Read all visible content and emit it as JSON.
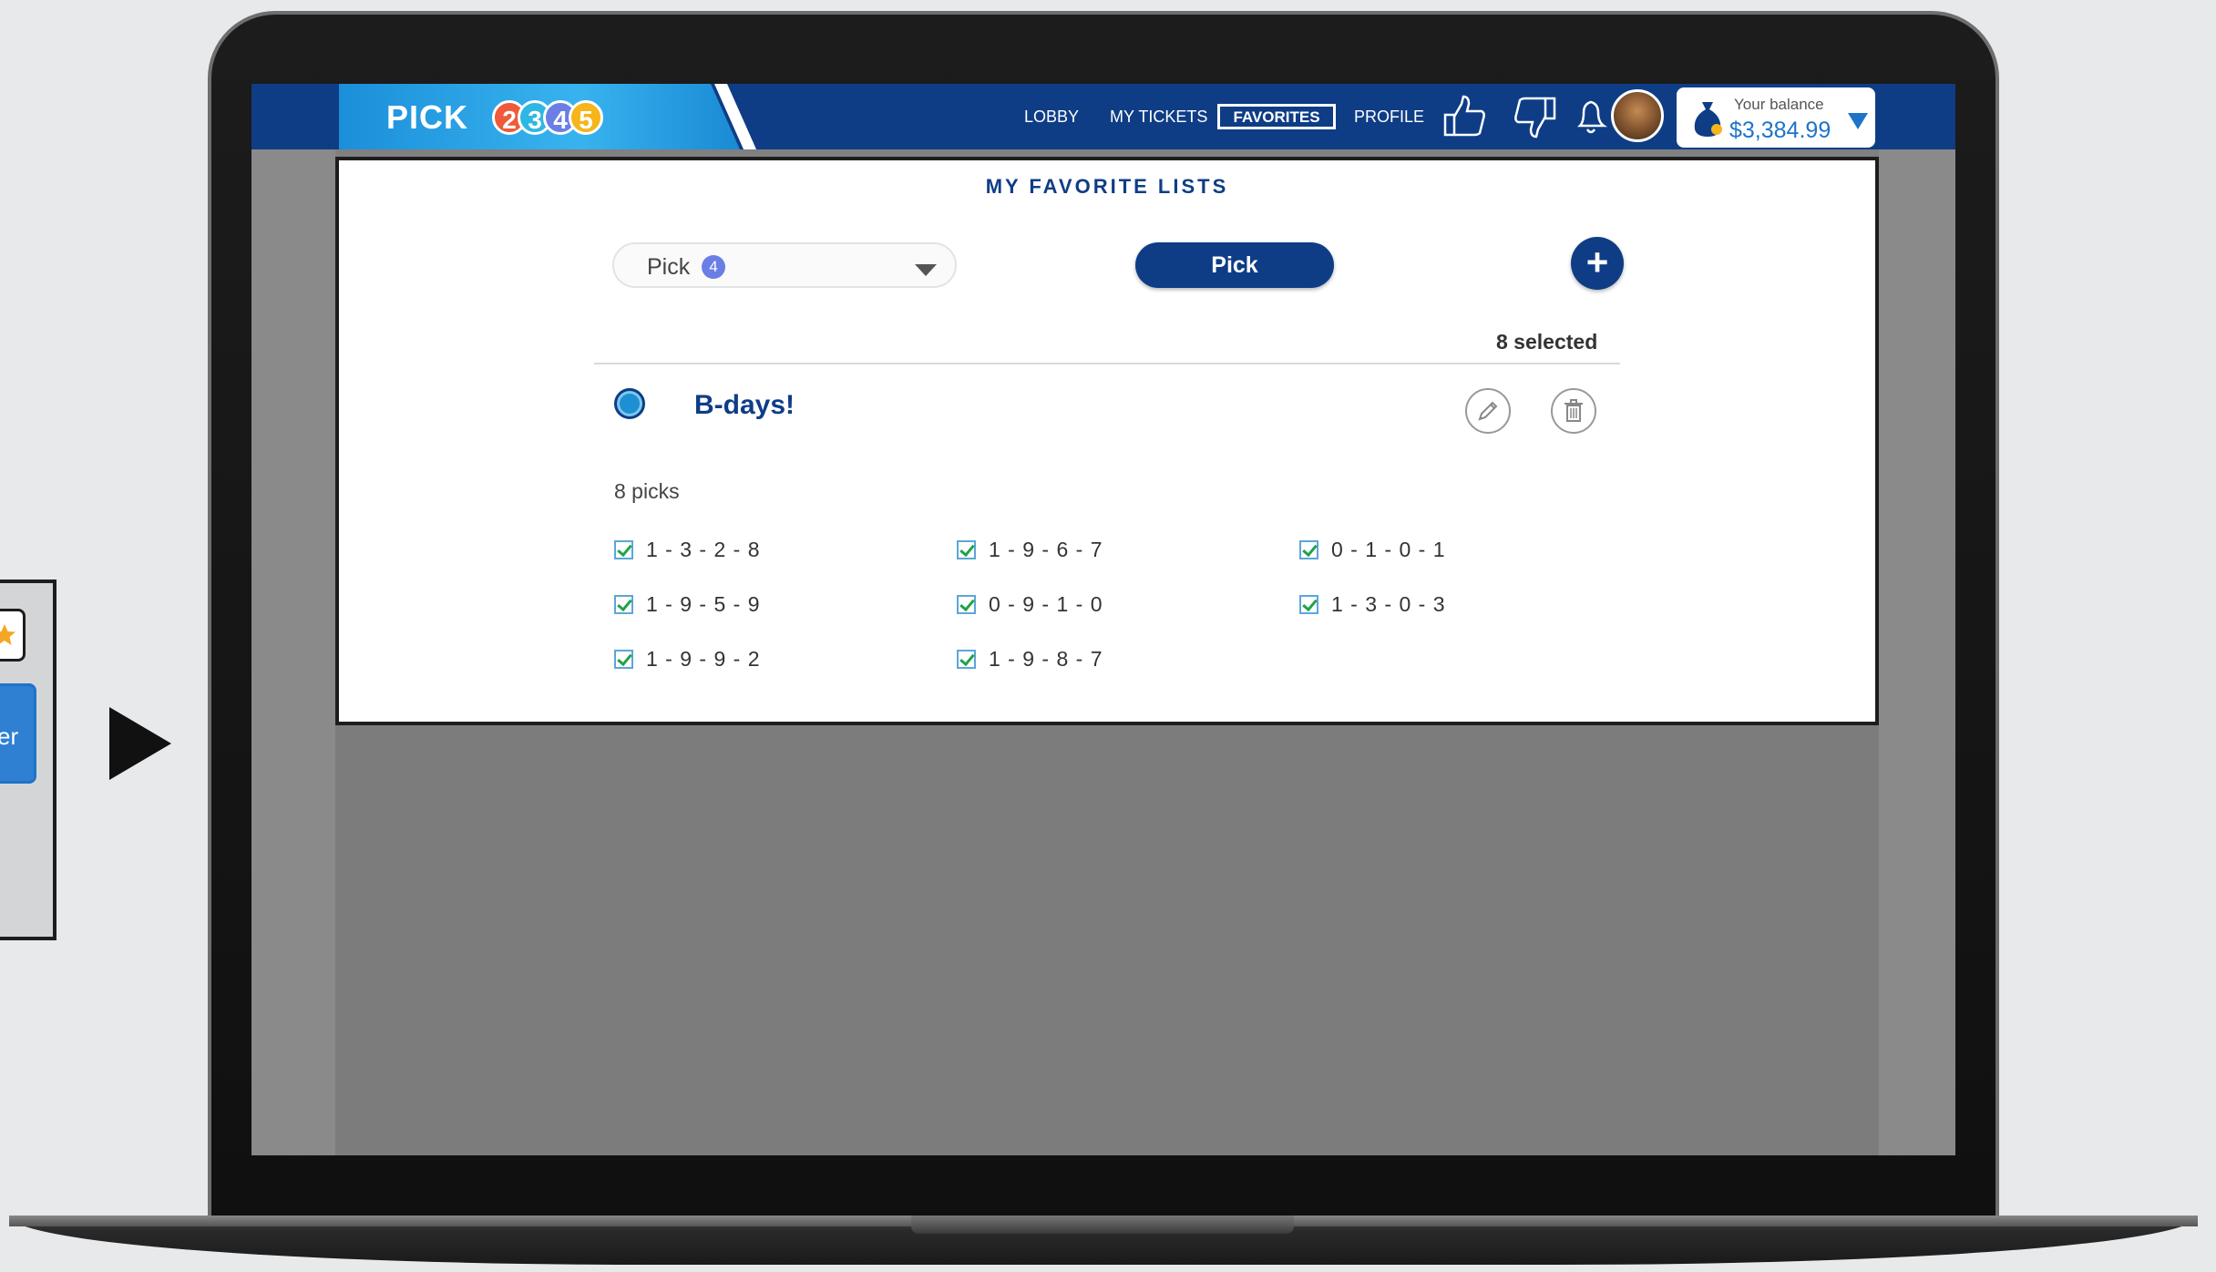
{
  "app": {
    "logo_text": "PICK",
    "logo_balls": [
      {
        "label": "2",
        "color": "#ef5a3a"
      },
      {
        "label": "3",
        "color": "#2fb7e3"
      },
      {
        "label": "4",
        "color": "#6b7ee6"
      },
      {
        "label": "5",
        "color": "#f5b51b"
      }
    ]
  },
  "nav": {
    "lobby": "LOBBY",
    "my_tickets": "MY TICKETS",
    "favorites": "FAVORITES",
    "profile": "PROFILE"
  },
  "balance": {
    "label": "Your balance",
    "value": "$3,384.99"
  },
  "favorites": {
    "title": "MY FAVORITE LISTS",
    "game_select": {
      "label": "Pick",
      "badge": "4"
    },
    "pick_button": "Pick",
    "add_button": "+",
    "selected_count": "8 selected",
    "list": {
      "name": "B-days!",
      "pick_count": "8 picks",
      "picks": [
        "1 - 3 - 2 - 8",
        "1 - 9 - 6 - 7",
        "0 - 1 - 0 - 1",
        "1 - 9 - 5 - 9",
        "0 - 9 - 1 - 0",
        "1 - 3 - 0 - 3",
        "1 - 9 - 9 - 2",
        "1 - 9 - 8 - 7"
      ]
    }
  },
  "side_panel": {
    "tab_label": "er"
  },
  "colors": {
    "header": "#0e3d86",
    "accent": "#1e74c8",
    "check": "#1fa34a"
  }
}
